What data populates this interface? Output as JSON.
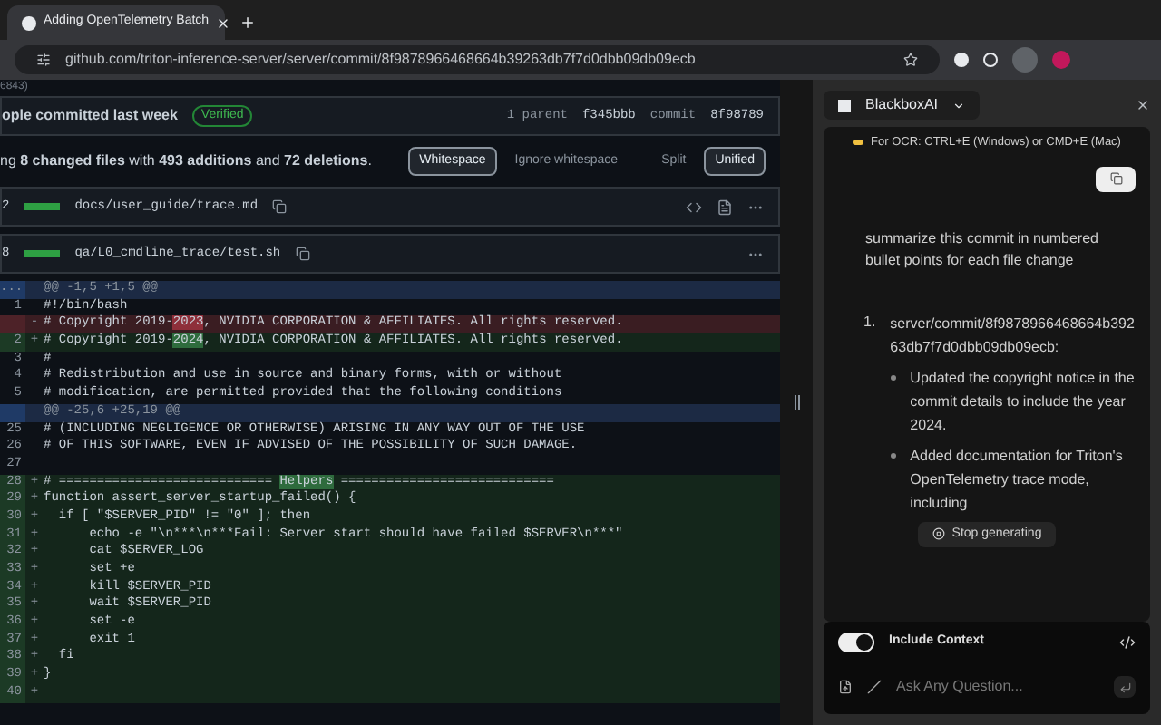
{
  "browser": {
    "tab_title": "Adding OpenTelemetry Batch",
    "url": "github.com/triton-inference-server/server/commit/8f9878966468664b39263db7f7d0dbb09db09ecb"
  },
  "commit": {
    "pr_ref": "6843)",
    "author_text": "ople committed last week",
    "verified": "Verified",
    "parent_label": "1 parent",
    "parent_sha": "f345bbb",
    "commit_label": "commit",
    "commit_sha": "8f98789"
  },
  "summary": {
    "text": "ng **8 changed files** with **493 additions** and **72 deletions**.",
    "buttons": [
      {
        "label": "Whitespace",
        "selected": true
      },
      {
        "label": "Ignore whitespace",
        "selected": false
      },
      {
        "label": "Split",
        "selected": false
      },
      {
        "label": "Unified",
        "selected": true
      }
    ]
  },
  "files": [
    {
      "count": "2",
      "path": "docs/user_guide/trace.md"
    },
    {
      "count": "8",
      "path": "qa/L0_cmdline_trace/test.sh"
    }
  ],
  "diff": [
    {
      "kind": "hunk",
      "num": "...",
      "parts": [
        {
          "text": "@@ -1,5 +1,5 @@"
        }
      ]
    },
    {
      "kind": "context",
      "num": "1",
      "parts": [
        {
          "text": "#!/bin/bash"
        }
      ]
    },
    {
      "kind": "del",
      "sign": "-",
      "parts": [
        {
          "text": "# Copyright 2019-"
        },
        {
          "text": "2023",
          "highlight": true
        },
        {
          "text": ", NVIDIA CORPORATION & AFFILIATES. All rights reserved."
        }
      ]
    },
    {
      "kind": "add",
      "num": "2",
      "sign": "+",
      "parts": [
        {
          "text": "# Copyright 2019-"
        },
        {
          "text": "2024",
          "highlight": true
        },
        {
          "text": ", NVIDIA CORPORATION & AFFILIATES. All rights reserved."
        }
      ]
    },
    {
      "kind": "context",
      "num": "3",
      "parts": [
        {
          "text": "#"
        }
      ]
    },
    {
      "kind": "context",
      "num": "4",
      "parts": [
        {
          "text": "# Redistribution and use in source and binary forms, with or without"
        }
      ]
    },
    {
      "kind": "context",
      "num": "5",
      "parts": [
        {
          "text": "# modification, are permitted provided that the following conditions"
        }
      ]
    },
    {
      "kind": "hunk",
      "parts": [
        {
          "text": "@@ -25,6 +25,19 @@"
        }
      ]
    },
    {
      "kind": "context",
      "num": "25",
      "parts": [
        {
          "text": "# (INCLUDING NEGLIGENCE OR OTHERWISE) ARISING IN ANY WAY OUT OF THE USE"
        }
      ]
    },
    {
      "kind": "context",
      "num": "26",
      "parts": [
        {
          "text": "# OF THIS SOFTWARE, EVEN IF ADVISED OF THE POSSIBILITY OF SUCH DAMAGE."
        }
      ]
    },
    {
      "kind": "context",
      "num": "27"
    },
    {
      "kind": "add",
      "num": "28",
      "sign": "+",
      "parts": [
        {
          "text": "# ============================ "
        },
        {
          "text": "Helpers",
          "highlight": true
        },
        {
          "text": " ============================"
        }
      ]
    },
    {
      "kind": "add",
      "num": "29",
      "sign": "+",
      "parts": [
        {
          "text": "function assert_server_startup_failed() {"
        }
      ]
    },
    {
      "kind": "add",
      "num": "30",
      "sign": "+",
      "parts": [
        {
          "text": "  if [ \"$SERVER_PID\" != \"0\" ]; then"
        }
      ]
    },
    {
      "kind": "add",
      "num": "31",
      "sign": "+",
      "parts": [
        {
          "text": "      echo -e \"\\n***\\n***Fail: Server start should have failed $SERVER\\n***\""
        }
      ]
    },
    {
      "kind": "add",
      "num": "32",
      "sign": "+",
      "parts": [
        {
          "text": "      cat $SERVER_LOG"
        }
      ]
    },
    {
      "kind": "add",
      "num": "33",
      "sign": "+",
      "parts": [
        {
          "text": "      set +e"
        }
      ]
    },
    {
      "kind": "add",
      "num": "34",
      "sign": "+",
      "parts": [
        {
          "text": "      kill $SERVER_PID"
        }
      ]
    },
    {
      "kind": "add",
      "num": "35",
      "sign": "+",
      "parts": [
        {
          "text": "      wait $SERVER_PID"
        }
      ]
    },
    {
      "kind": "add",
      "num": "36",
      "sign": "+",
      "parts": [
        {
          "text": "      set -e"
        }
      ]
    },
    {
      "kind": "add",
      "num": "37",
      "sign": "+",
      "parts": [
        {
          "text": "      exit 1"
        }
      ]
    },
    {
      "kind": "add",
      "num": "38",
      "sign": "+",
      "parts": [
        {
          "text": "  fi"
        }
      ]
    },
    {
      "kind": "add",
      "num": "39",
      "sign": "+",
      "parts": [
        {
          "text": "}"
        }
      ]
    },
    {
      "kind": "add",
      "num": "40",
      "sign": "+"
    }
  ],
  "assistant": {
    "title": "BlackboxAI",
    "ocr_hint": "For OCR: CTRL+E (Windows) or CMD+E (Mac)",
    "question": "summarize this commit in numbered bullet points for each file change",
    "answer": [
      {
        "marker": "1.",
        "text": "server/commit/8f9878966468664b39263db7f7d0dbb09db09ecb:",
        "bullets": [
          "Updated the copyright notice in the commit details to include the year 2024.",
          "Added documentation for Triton's OpenTelemetry trace mode, including"
        ]
      }
    ],
    "stop_label": "Stop generating",
    "include_context": {
      "label": "Include Context",
      "on": true
    },
    "input": {
      "placeholder": "Ask Any Question..."
    }
  }
}
